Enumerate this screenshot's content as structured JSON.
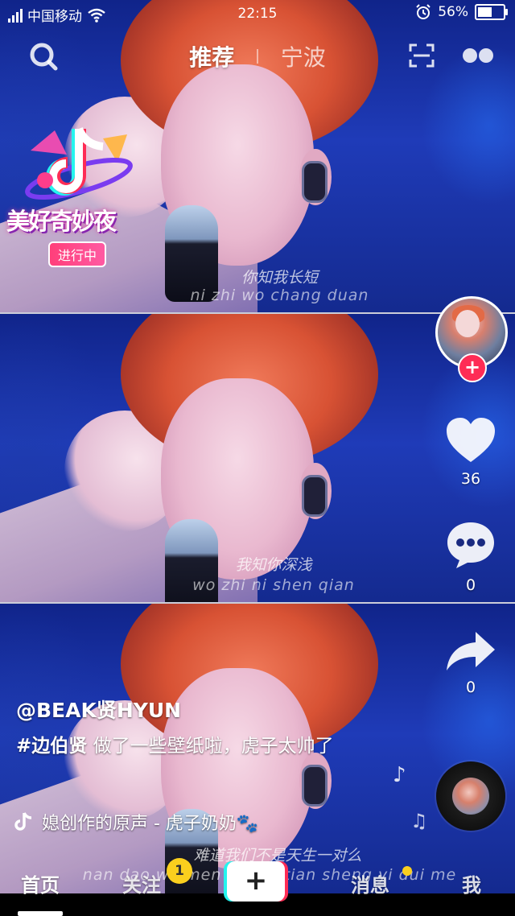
{
  "status_bar": {
    "carrier": "中国移动",
    "time": "22:15",
    "battery_percent": "56%",
    "battery_level": 0.56
  },
  "top_nav": {
    "tab_recommend": "推荐",
    "tab_city": "宁波"
  },
  "event_badge": {
    "title": "美好奇妙夜",
    "status": "进行中"
  },
  "video": {
    "lyrics": [
      {
        "chinese": "你知我长短",
        "pinyin": "ni zhi wo chang duan"
      },
      {
        "chinese": "我知你深浅",
        "pinyin": "wo zhi ni shen qian"
      },
      {
        "chinese": "难道我们不是天生一对么",
        "pinyin": "nan dao wo men bu shi tian sheng yi dui me"
      }
    ]
  },
  "right_rail": {
    "like_count": "36",
    "comment_count": "0",
    "share_count": "0"
  },
  "post": {
    "author": "@BEAK贤HYUN",
    "hashtag": "#边伯贤",
    "caption": " 做了一些壁纸啦，虎子太帅了",
    "music": "媳创作的原声 - 虎子奶奶🐾"
  },
  "bottom_nav": {
    "home": "首页",
    "follow": "关注",
    "follow_badge": "1",
    "add": "+",
    "messages": "消息",
    "me": "我"
  },
  "colors": {
    "accent_red": "#fe2c55",
    "accent_cyan": "#25f4ee",
    "badge_yellow": "#facf1e"
  },
  "icons": [
    "search-icon",
    "scan-icon",
    "more-icon",
    "heart-icon",
    "comment-icon",
    "share-icon",
    "music-note-icon",
    "tiktok-logo-icon",
    "plus-icon"
  ]
}
